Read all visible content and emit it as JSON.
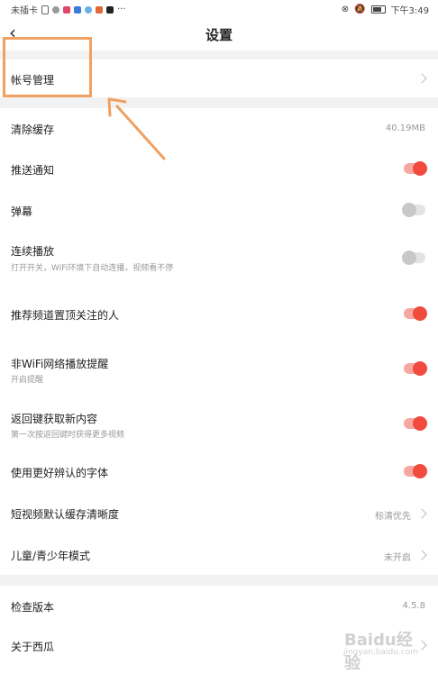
{
  "status_bar": {
    "left_text": "未插卡",
    "right_time": "下午3:49",
    "overflow_dots": "···"
  },
  "header": {
    "title": "设置"
  },
  "section1": {
    "account": "帐号管理"
  },
  "section2": {
    "clear_cache": {
      "label": "清除缓存",
      "value": "40.19MB"
    },
    "push": {
      "label": "推送通知",
      "on": true
    },
    "danmaku": {
      "label": "弹幕",
      "on": false
    },
    "autoplay": {
      "label": "连续播放",
      "sub": "打开开关，WiFi环境下自动连播，视频看不停",
      "on": false
    },
    "pin_follow": {
      "label": "推荐频道置顶关注的人",
      "on": true
    },
    "nonwifi": {
      "label": "非WiFi网络播放提醒",
      "sub": "开启提醒",
      "on": true
    },
    "back_refresh": {
      "label": "返回键获取新内容",
      "sub": "第一次按返回键时获得更多视频",
      "on": true
    },
    "font": {
      "label": "使用更好辨认的字体",
      "on": true
    },
    "short_video_quality": {
      "label": "短视频默认缓存清晰度",
      "value": "标清优先"
    },
    "kids_mode": {
      "label": "儿童/青少年模式",
      "value": "未开启"
    }
  },
  "section3": {
    "check_version": {
      "label": "检查版本",
      "value": "4.5.8"
    },
    "about": {
      "label": "关于西瓜"
    }
  },
  "watermark": {
    "name": "Baidu经验",
    "url": "jingyan.baidu.com"
  },
  "colors": {
    "toggle_on": "#f04b3c",
    "toggle_off": "#c8c8c8",
    "annotation": "#f0a060"
  }
}
